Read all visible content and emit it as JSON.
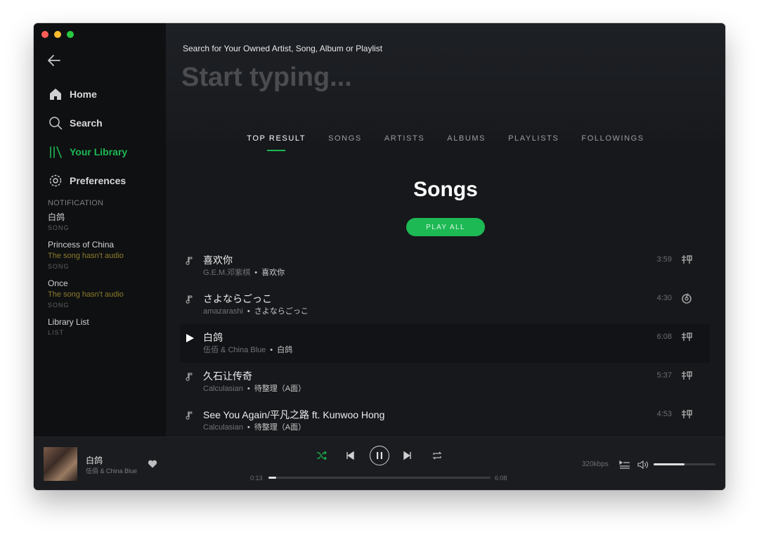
{
  "sidebar": {
    "nav": [
      {
        "label": "Home",
        "icon": "home-icon"
      },
      {
        "label": "Search",
        "icon": "search-icon"
      },
      {
        "label": "Your Library",
        "icon": "library-icon",
        "active": true
      },
      {
        "label": "Preferences",
        "icon": "gear-icon"
      }
    ],
    "notifications": {
      "heading": "NOTIFICATION",
      "items": [
        {
          "title": "白鸽",
          "message": "",
          "type": "SONG"
        },
        {
          "title": "Princess of China",
          "message": "The song hasn't audio",
          "type": "SONG"
        },
        {
          "title": "Once",
          "message": "The song hasn't audio",
          "type": "SONG"
        },
        {
          "title": "Library List",
          "message": "",
          "type": "LIST"
        }
      ]
    }
  },
  "search": {
    "hint": "Search for Your Owned Artist, Song, Album or Playlist",
    "placeholder": "Start typing...",
    "value": ""
  },
  "tabs": [
    {
      "label": "TOP RESULT",
      "active": true
    },
    {
      "label": "SONGS"
    },
    {
      "label": "ARTISTS"
    },
    {
      "label": "ALBUMS"
    },
    {
      "label": "PLAYLISTS"
    },
    {
      "label": "FOLLOWINGS"
    }
  ],
  "section": {
    "title": "Songs",
    "play_all": "PLAY ALL"
  },
  "songs": [
    {
      "title": "喜欢你",
      "artist": "G.E.M.邓紫棋",
      "album": "喜欢你",
      "duration": "3:59",
      "source": "xiami-icon",
      "playing": false
    },
    {
      "title": "さよならごっこ",
      "artist": "amazarashi",
      "album": "さよならごっこ",
      "duration": "4:30",
      "source": "netease-icon",
      "playing": false
    },
    {
      "title": "白鸽",
      "artist": "伍佰 & China Blue",
      "album": "白鸽",
      "duration": "6:08",
      "source": "xiami-icon",
      "playing": true
    },
    {
      "title": "久石让传奇",
      "artist": "Calculasian",
      "album": "待整理（A面）",
      "duration": "5:37",
      "source": "xiami-icon",
      "playing": false
    },
    {
      "title": "See You Again/平凡之路 ft. Kunwoo Hong",
      "artist": "Calculasian",
      "album": "待整理（A面）",
      "duration": "4:53",
      "source": "xiami-icon",
      "playing": false
    }
  ],
  "player": {
    "title": "白鸽",
    "artist": "伍佰 & China Blue",
    "current_time": "0:13",
    "total_time": "6:08",
    "progress": 0.035,
    "bitrate": "320kbps",
    "volume": 0.5
  },
  "colors": {
    "accent": "#1db954",
    "warning": "#8b7c2b"
  }
}
